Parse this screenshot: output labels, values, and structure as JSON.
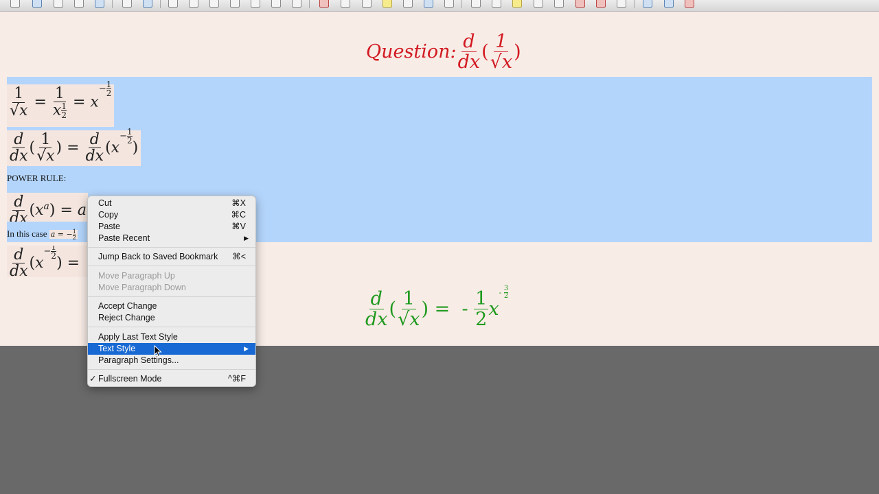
{
  "question": {
    "prefix": "Question:",
    "d": "d",
    "dx": "dx",
    "one": "1",
    "x": "x"
  },
  "math": {
    "line1": {
      "one": "1",
      "x": "x",
      "eq": "=",
      "x_half": "x",
      "half_num": "1",
      "half_den": "2",
      "rhs_x": "x",
      "minus": "−"
    },
    "line2": {
      "d": "d",
      "dx": "dx",
      "one": "1",
      "x": "x",
      "eq": "=",
      "rhs_x": "x",
      "minus": "−",
      "half_num": "1",
      "half_den": "2"
    },
    "power_rule_label": "POWER RULE:",
    "line3": {
      "d": "d",
      "dx": "dx",
      "x": "x",
      "a": "a",
      "eq": "=",
      "rest": "a"
    },
    "in_this_case": "In this case",
    "case_expr": {
      "a": "a",
      "eq": "=",
      "minus": "−",
      "half_num": "1",
      "half_den": "2"
    },
    "line4": {
      "d": "d",
      "dx": "dx",
      "x": "x",
      "minus": "−",
      "half_num": "1",
      "half_den": "2",
      "eq": "="
    }
  },
  "answer": {
    "d": "d",
    "dx": "dx",
    "one": "1",
    "x": "x",
    "eq": "=",
    "minus": "-",
    "coef_num": "1",
    "coef_den": "2",
    "xx": "x",
    "exp_minus": "-",
    "exp_num": "3",
    "exp_den": "2"
  },
  "context_menu": {
    "cut": {
      "label": "Cut",
      "shortcut": "⌘X"
    },
    "copy": {
      "label": "Copy",
      "shortcut": "⌘C"
    },
    "paste": {
      "label": "Paste",
      "shortcut": "⌘V"
    },
    "paste_recent": {
      "label": "Paste Recent",
      "arrow": "▶"
    },
    "jump_back": {
      "label": "Jump Back to Saved Bookmark",
      "shortcut": "⌘<"
    },
    "move_up": {
      "label": "Move Paragraph Up"
    },
    "move_down": {
      "label": "Move Paragraph Down"
    },
    "accept_change": {
      "label": "Accept Change"
    },
    "reject_change": {
      "label": "Reject Change"
    },
    "apply_last_style": {
      "label": "Apply Last Text Style"
    },
    "text_style": {
      "label": "Text Style",
      "arrow": "▶"
    },
    "paragraph_settings": {
      "label": "Paragraph Settings..."
    },
    "fullscreen": {
      "label": "Fullscreen Mode",
      "shortcut": "^⌘F",
      "check": "✓"
    }
  },
  "colors": {
    "question": "#d21a22",
    "answer": "#1f9a1f",
    "selection": "#b4d5fb",
    "menu_highlight": "#1869d3",
    "page": "#f8ece6",
    "background": "#696969"
  },
  "icons": [
    "view-icon",
    "refresh-icon",
    "align-left-icon",
    "indent-icon",
    "table-icon",
    "image-icon",
    "note-icon",
    "tex-icon",
    "attachment-icon",
    "sidebar-icon"
  ]
}
